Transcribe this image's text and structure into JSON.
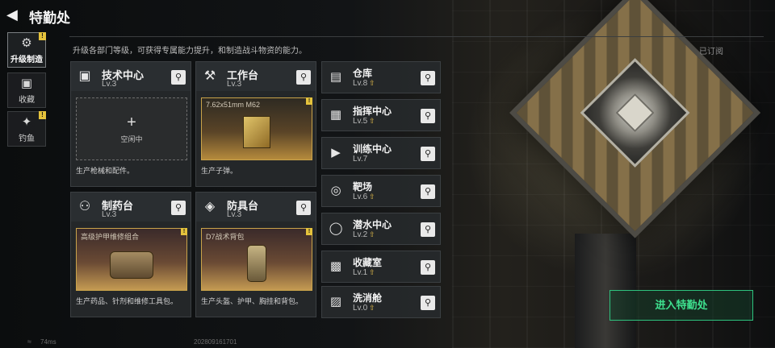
{
  "header": {
    "title": "特勤处"
  },
  "side_tabs": [
    {
      "label": "升级制造",
      "badge": "!"
    },
    {
      "label": "收藏",
      "badge": ""
    },
    {
      "label": "钓鱼",
      "badge": "!"
    }
  ],
  "description": "升级各部门等级，可获得专属能力提升，和制造战斗物资的能力。",
  "subscribed": "已订阅",
  "cards": [
    {
      "name": "技术中心",
      "level": "Lv.3",
      "slot_idle": "空闲中",
      "footer": "生产枪械和配件。"
    },
    {
      "name": "工作台",
      "level": "Lv.3",
      "slot_item": "7.62x51mm M62",
      "footer": "生产子弹。"
    },
    {
      "name": "制药台",
      "level": "Lv.3",
      "slot_item": "高级护甲维修组合",
      "footer": "生产药品、针剂和维修工具包。"
    },
    {
      "name": "防具台",
      "level": "Lv.3",
      "slot_item": "D7战术背包",
      "footer": "生产头盔、护甲、胸挂和背包。"
    }
  ],
  "rows": [
    {
      "name": "仓库",
      "level": "Lv.8"
    },
    {
      "name": "指挥中心",
      "level": "Lv.5"
    },
    {
      "name": "训练中心",
      "level": "Lv.7"
    },
    {
      "name": "靶场",
      "level": "Lv.6"
    },
    {
      "name": "潜水中心",
      "level": "Lv.2"
    },
    {
      "name": "收藏室",
      "level": "Lv.1"
    },
    {
      "name": "洗消舱",
      "level": "Lv.0"
    }
  ],
  "enter_button": "进入特勤处",
  "status": {
    "ping": "74ms",
    "uid": "202809161701"
  },
  "colors": {
    "accent_green": "#3ee08e",
    "badge_yellow": "#e5c33c"
  }
}
